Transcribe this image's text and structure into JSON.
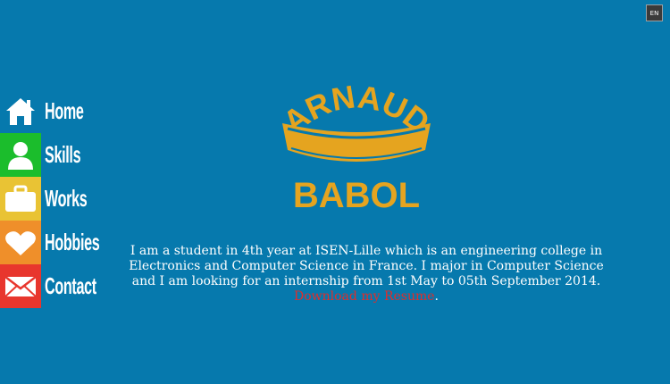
{
  "lang_button": {
    "label": "EN"
  },
  "logo": {
    "top_text": "ARNAUD",
    "bottom_text": "BABOL"
  },
  "nav": {
    "items": [
      {
        "label": "Home",
        "icon": "home-icon",
        "color": "#0679ad"
      },
      {
        "label": "Skills",
        "icon": "user-icon",
        "color": "#1bbd2c"
      },
      {
        "label": "Works",
        "icon": "briefcase-icon",
        "color": "#e9c334"
      },
      {
        "label": "Hobbies",
        "icon": "heart-icon",
        "color": "#ef8f2a"
      },
      {
        "label": "Contact",
        "icon": "envelope-icon",
        "color": "#e8362d"
      }
    ]
  },
  "intro": {
    "text": "I am a student in 4th year at ISEN-Lille which is an engineering college in Electronics and Computer Science in France. I major in Computer Science and I am looking for an internship from 1st May to 05th September 2014.",
    "link_text": "Download my Resume",
    "trailing": "."
  },
  "colors": {
    "background": "#0679ad",
    "logo": "#e5a41f",
    "link": "#e02d2b"
  }
}
